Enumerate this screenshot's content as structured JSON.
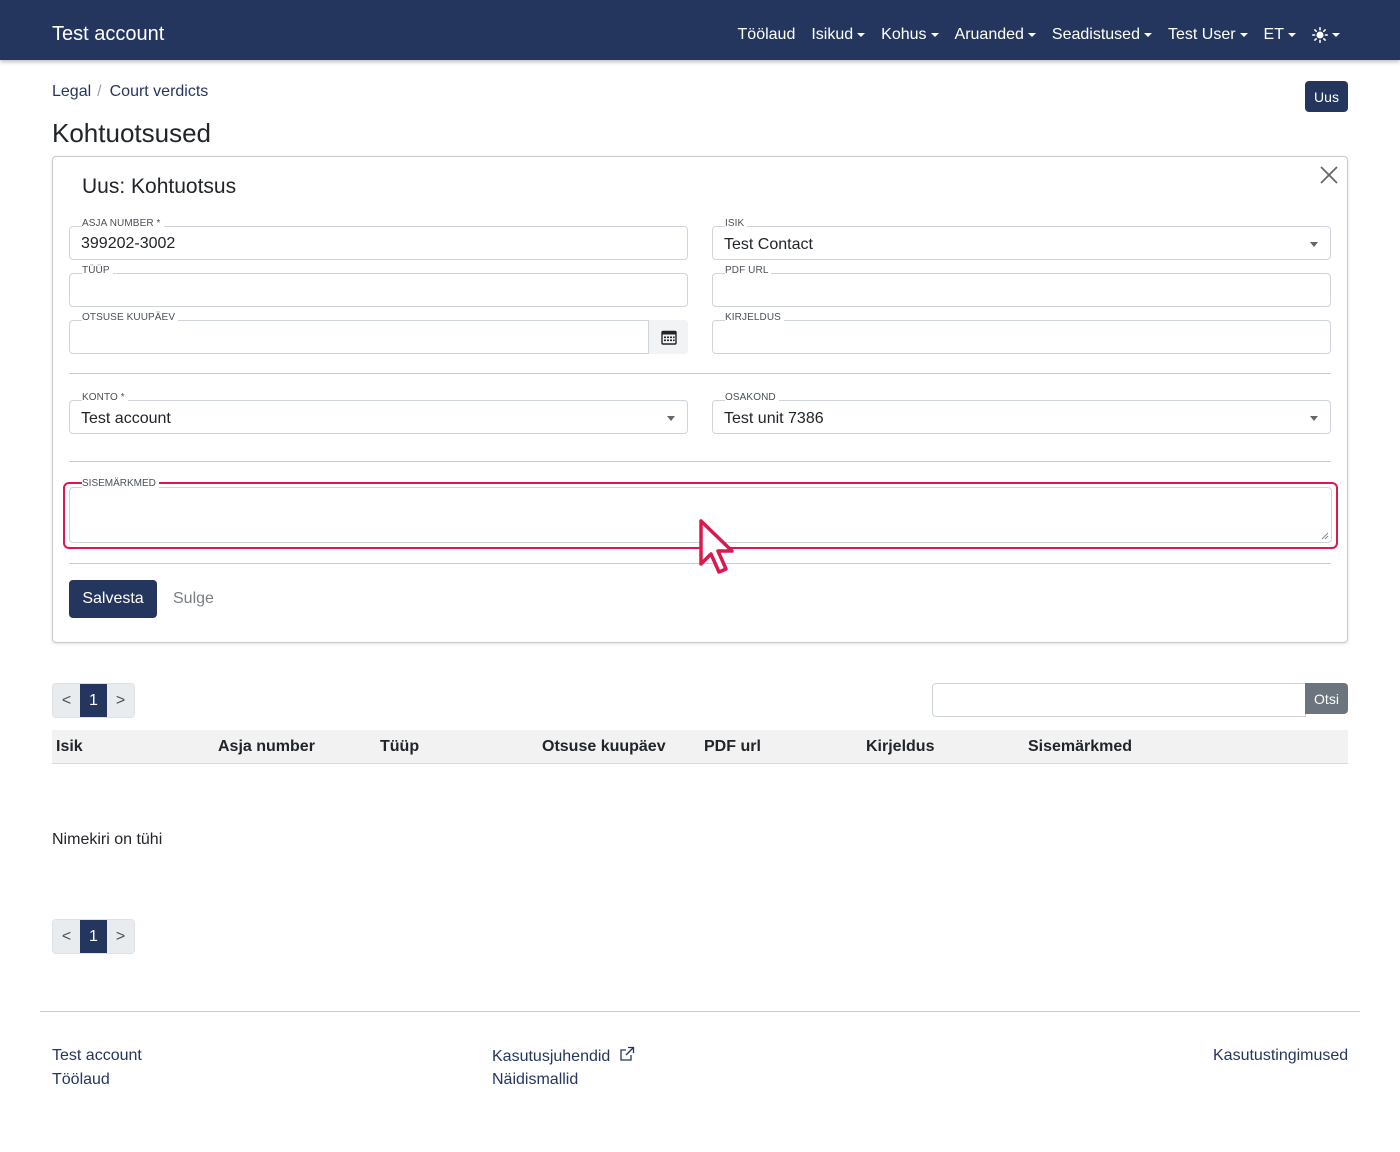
{
  "navbar": {
    "brand": "Test account",
    "items": [
      {
        "label": "Töölaud",
        "dropdown": false
      },
      {
        "label": "Isikud",
        "dropdown": true
      },
      {
        "label": "Kohus",
        "dropdown": true
      },
      {
        "label": "Aruanded",
        "dropdown": true
      },
      {
        "label": "Seadistused",
        "dropdown": true
      },
      {
        "label": "Test User",
        "dropdown": true
      },
      {
        "label": "ET",
        "dropdown": true
      }
    ],
    "theme_icon": "sun-icon"
  },
  "breadcrumb": {
    "items": [
      "Legal",
      "Court verdicts"
    ],
    "separator": "/"
  },
  "header": {
    "new_button": "Uus",
    "title": "Kohtuotsused"
  },
  "form": {
    "title": "Uus: Kohtuotsus",
    "fields": {
      "case_number": {
        "label": "ASJA NUMBER *",
        "value": "399202-3002"
      },
      "person": {
        "label": "ISIK",
        "value": "Test Contact"
      },
      "type": {
        "label": "TÜÜP",
        "value": ""
      },
      "pdf_url": {
        "label": "PDF URL",
        "value": ""
      },
      "decision_date": {
        "label": "OTSUSE KUUPÄEV",
        "value": ""
      },
      "description": {
        "label": "KIRJELDUS",
        "value": ""
      },
      "account": {
        "label": "KONTO *",
        "value": "Test account"
      },
      "department": {
        "label": "OSAKOND",
        "value": "Test unit 7386"
      },
      "internal_notes": {
        "label": "SISEMÄRKMED",
        "value": ""
      }
    },
    "save_button": "Salvesta",
    "close_link": "Sulge"
  },
  "pagination": {
    "prev": "<",
    "current": "1",
    "next": ">"
  },
  "search": {
    "placeholder": "",
    "button": "Otsi"
  },
  "table": {
    "columns": [
      "Isik",
      "Asja number",
      "Tüüp",
      "Otsuse kuupäev",
      "PDF url",
      "Kirjeldus",
      "Sisemärkmed"
    ],
    "empty_message": "Nimekiri on tühi"
  },
  "footer": {
    "left": [
      "Test account",
      "Töölaud"
    ],
    "center": [
      "Kasutusjuhendid",
      "Näidismallid"
    ],
    "right": [
      "Kasutustingimused"
    ]
  },
  "colors": {
    "primary": "#25365e",
    "highlight": "#d81b4e",
    "secondary_button": "#6c757d"
  }
}
